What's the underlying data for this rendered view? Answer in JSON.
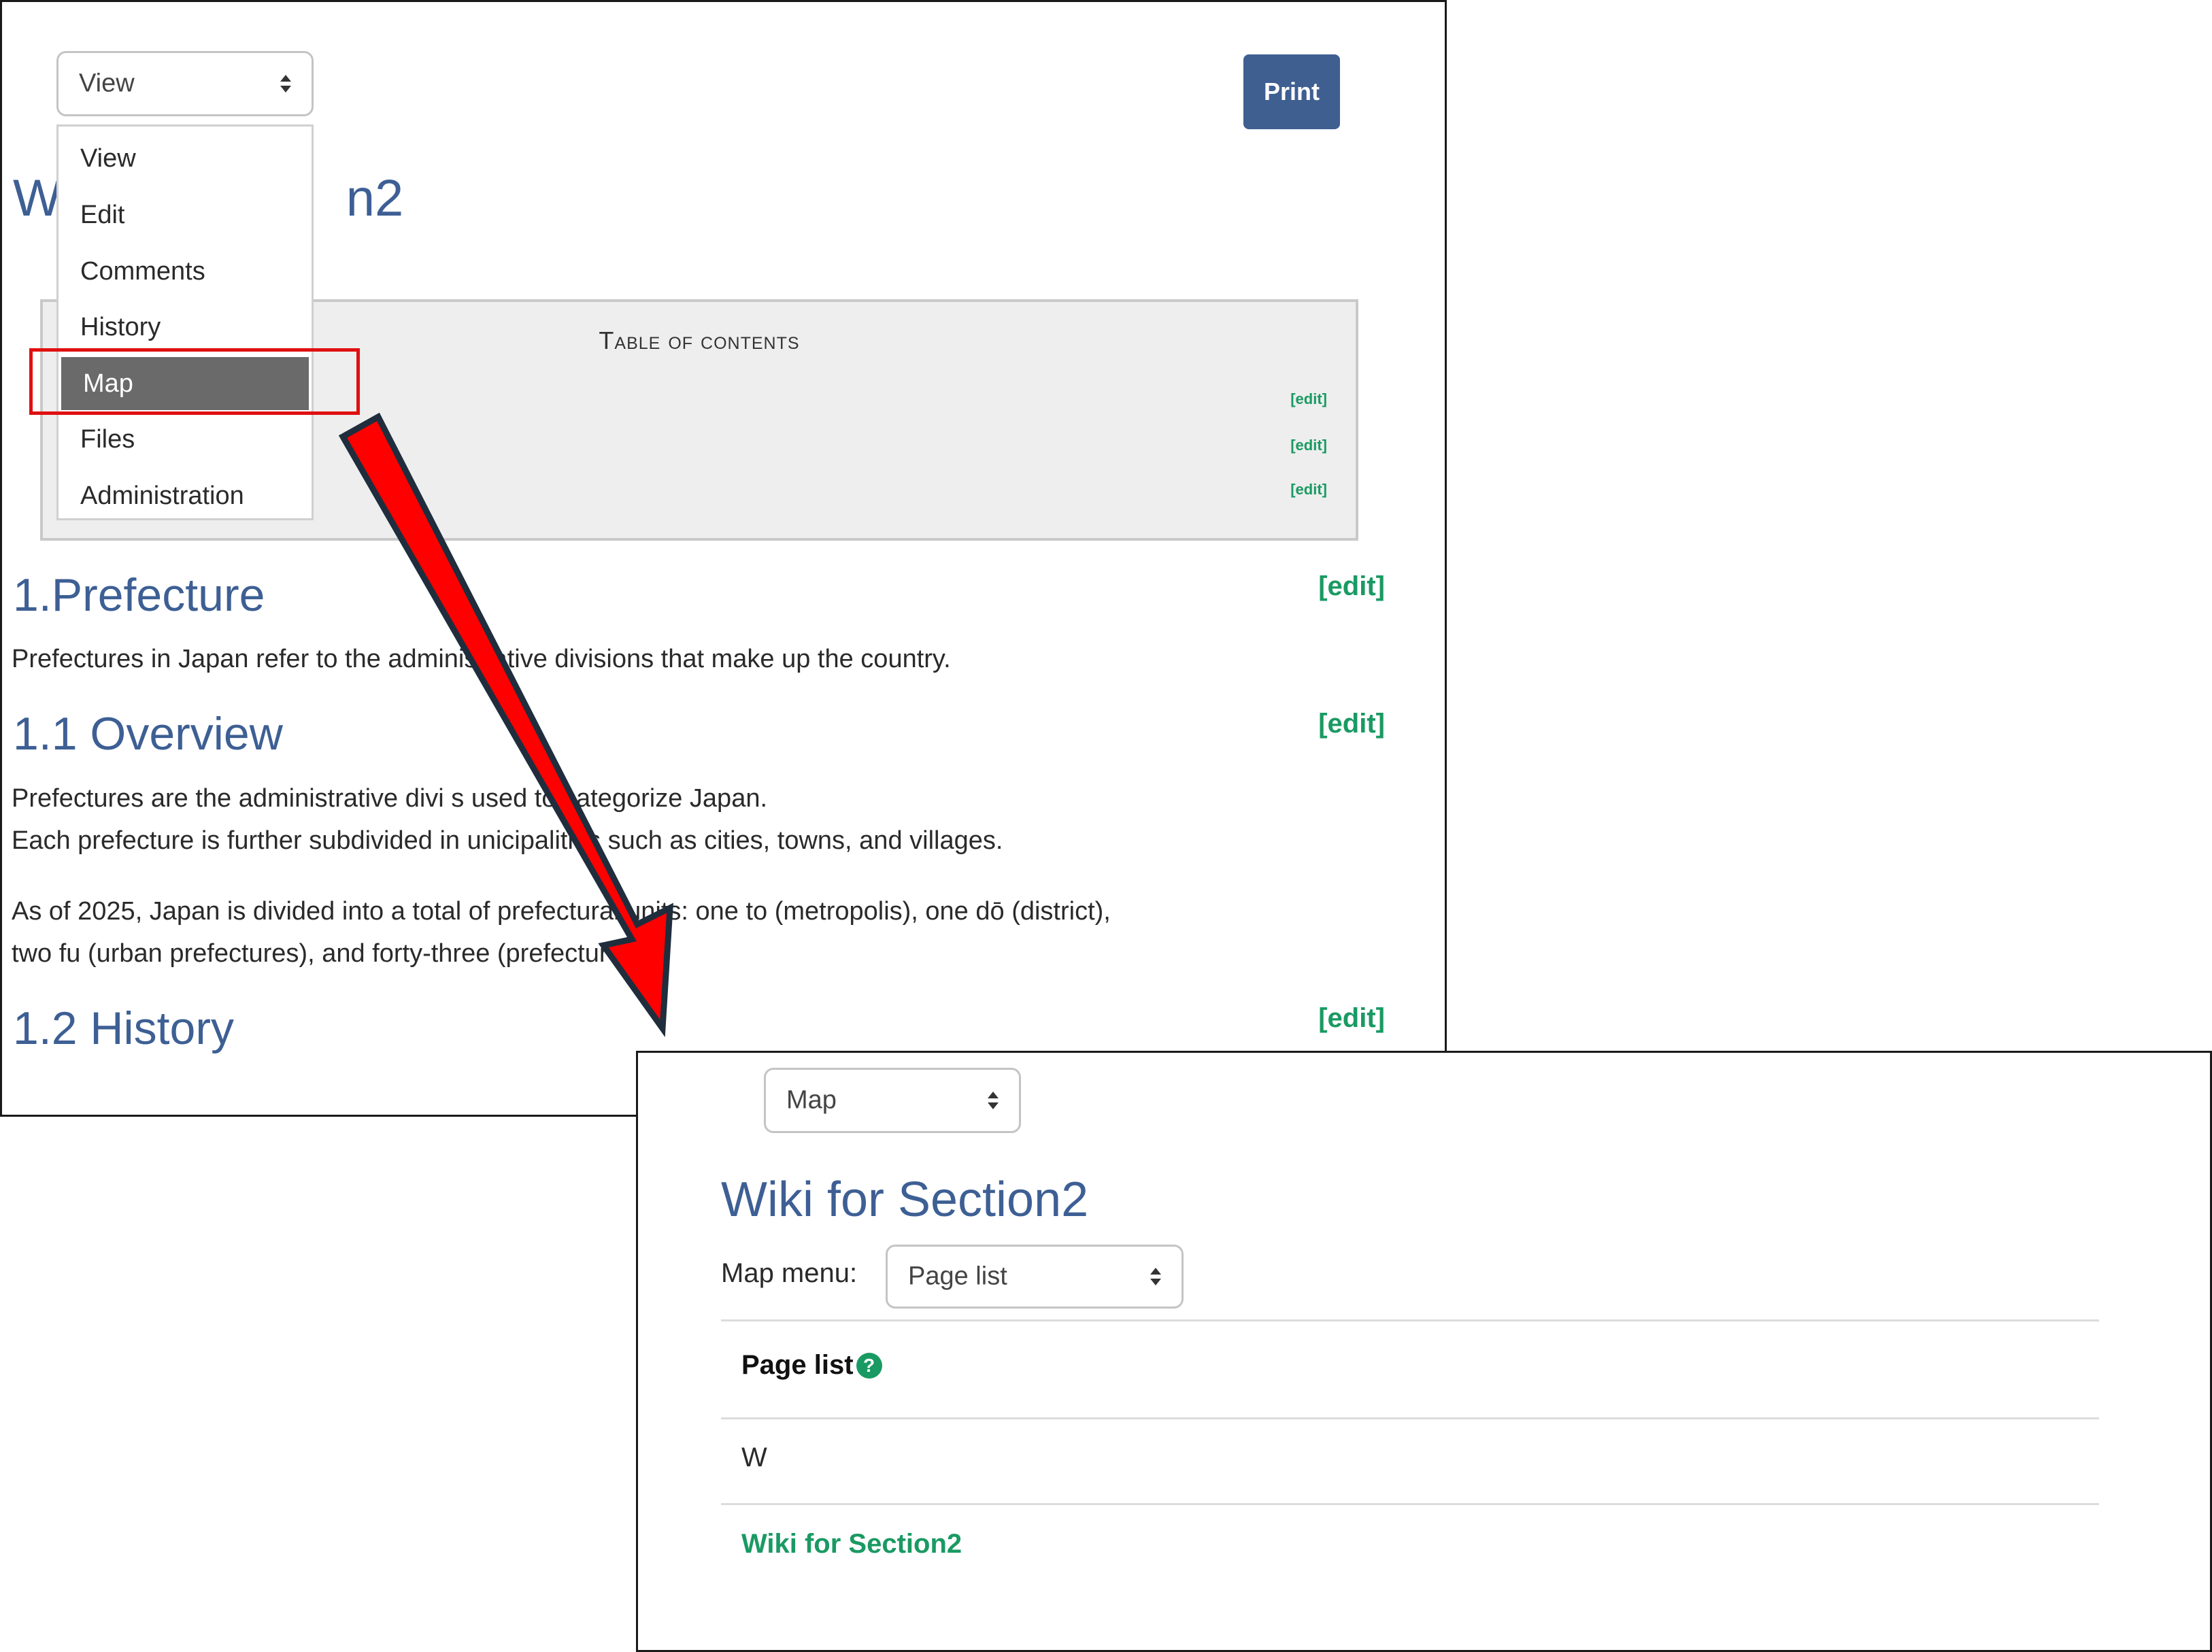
{
  "panel1": {
    "view_select": {
      "value": "View"
    },
    "print_button": "Print",
    "page_title_visible": [
      "W",
      "n2"
    ],
    "dropdown_options": [
      "View",
      "Edit",
      "Comments",
      "History",
      "Map",
      "Files",
      "Administration"
    ],
    "dropdown_selected": "Map",
    "toc": {
      "title": "Table of contents",
      "edit_links": [
        "[edit]",
        "[edit]",
        "[edit]"
      ]
    },
    "sections": [
      {
        "heading": "1.Prefecture",
        "edit": "[edit]"
      },
      {
        "heading": "1.1 Overview",
        "edit": "[edit]"
      },
      {
        "heading": "1.2 History",
        "edit": "[edit]"
      }
    ],
    "paragraphs": [
      "Prefectures in Japan refer to the     administrative divisions that make up the country.",
      "Prefectures are the administrative divi     s used to categorize Japan.",
      "Each prefecture is further subdivided in      unicipalities such as cities, towns, and villages.",
      "As of 2025, Japan is divided into a total of      prefectural units: one to (metropolis), one dō (district),",
      "two fu (urban prefectures), and forty-three      (prefectures)."
    ]
  },
  "panel2": {
    "view_select": {
      "value": "Map"
    },
    "page_title": "Wiki for Section2",
    "map_menu": {
      "label": "Map menu:",
      "value": "Page list"
    },
    "page_list_header": "Page list",
    "help_icon": "?",
    "index_letter": "W",
    "pages": [
      "Wiki for Section2"
    ]
  },
  "colors": {
    "title_blue": "#3d5f94",
    "edit_green": "#1a9a63",
    "highlight_red": "#e01010",
    "arrow_red": "#ff0000",
    "arrow_outline": "#1f2d3d",
    "print_button": "#3f5f91"
  }
}
